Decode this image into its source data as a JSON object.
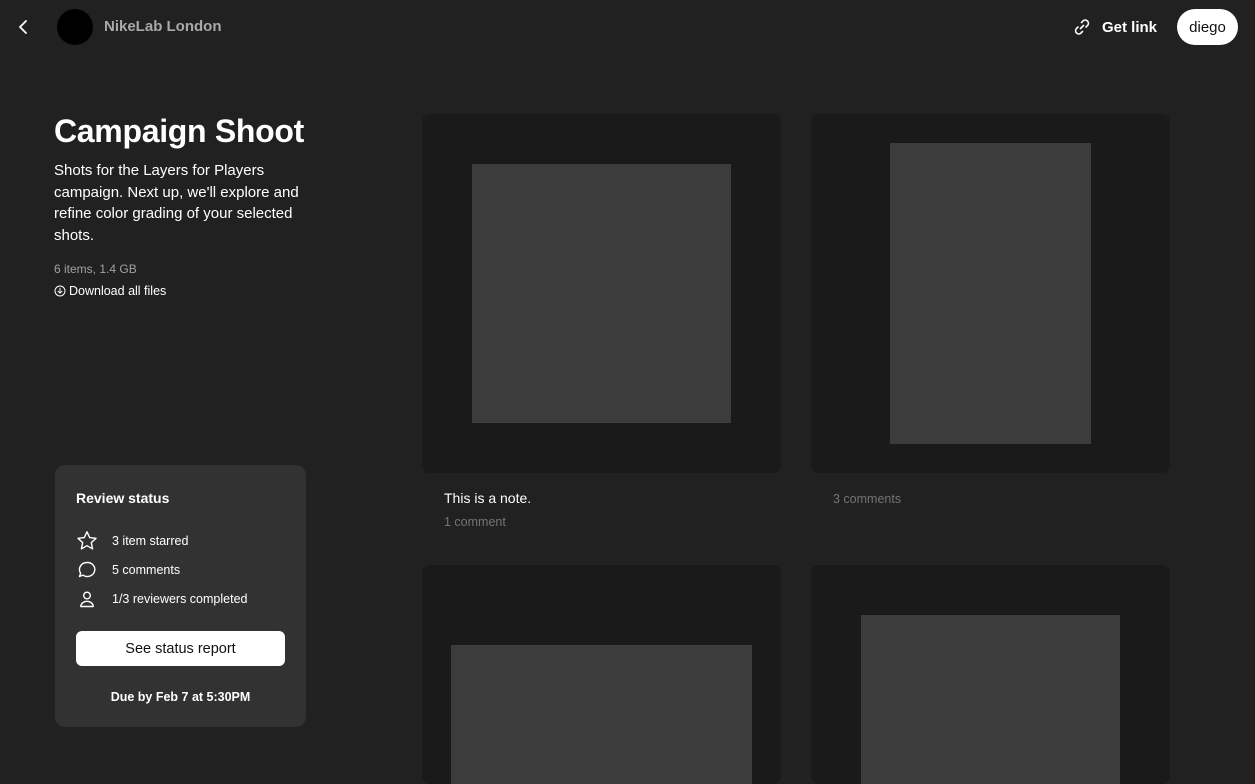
{
  "header": {
    "brand_name": "NikeLab London",
    "get_link_label": "Get link",
    "user_name": "diego"
  },
  "project": {
    "title": "Campaign Shoot",
    "description": "Shots for the Layers for Players campaign. Next up, we'll explore and refine color grading of your selected shots.",
    "meta": "6 items, 1.4 GB",
    "download_label": "Download all files"
  },
  "review": {
    "title": "Review status",
    "starred": "3 item starred",
    "comments": "5 comments",
    "reviewers": "1/3 reviewers completed",
    "button_label": "See status report",
    "due": "Due by Feb 7 at 5:30PM"
  },
  "items": [
    {
      "note": "This is a note.",
      "comments": "1 comment"
    },
    {
      "note": "",
      "comments": "3 comments"
    },
    {
      "note": "",
      "comments": ""
    },
    {
      "note": "",
      "comments": ""
    }
  ],
  "colors": {
    "background": "#212121",
    "card": "#323232",
    "tile": "#1a1a1a",
    "placeholder": "#3c3c3c"
  }
}
